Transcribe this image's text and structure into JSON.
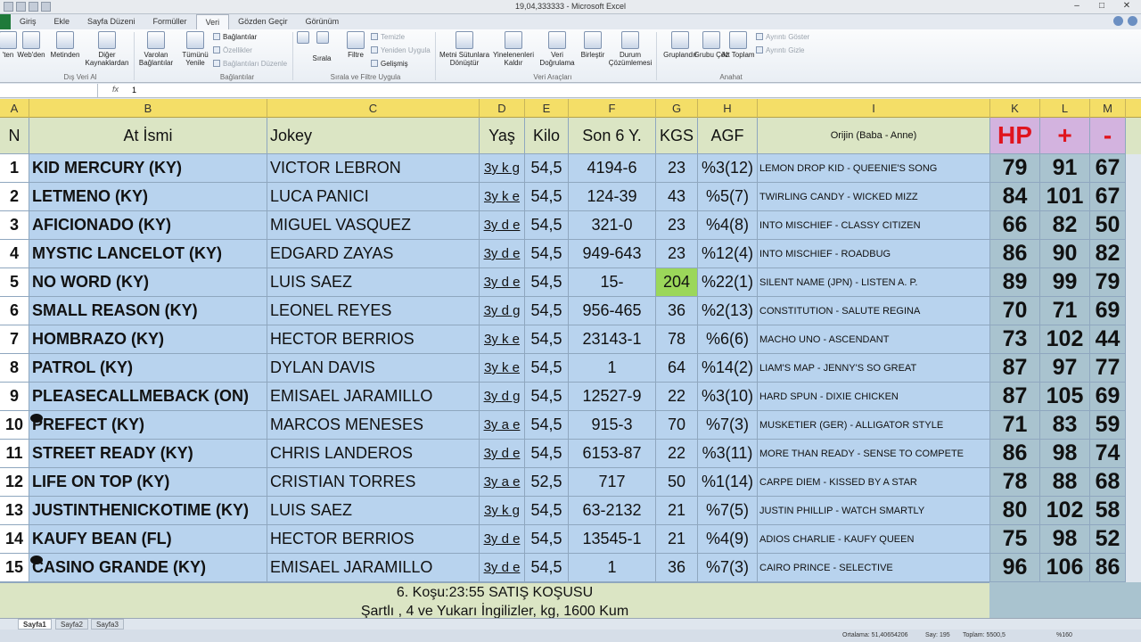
{
  "window": {
    "title": "19,04,333333 - Microsoft Excel"
  },
  "tabs": [
    "",
    "Giriş",
    "Ekle",
    "Sayfa Düzeni",
    "Formüller",
    "Veri",
    "Gözden Geçir",
    "Görünüm"
  ],
  "ribbon": {
    "buttons": [
      "'ten",
      "Web'den",
      "Metinden",
      "Diğer Kaynaklardan",
      "Varolan Bağlantılar",
      "Tümünü Yenile",
      "Sırala",
      "Filtre",
      "Metni Sütunlara Dönüştür",
      "Yinelenenleri Kaldır",
      "Veri Doğrulama",
      "Birleştir",
      "Durum Çözümlemesi",
      "Gruplandır",
      "Grubu Çöz",
      "Alt Toplam"
    ],
    "small": [
      "Bağlantılar",
      "Özellikler",
      "Bağlantıları Düzenle",
      "Temizle",
      "Yeniden Uygula",
      "Gelişmiş",
      "Ayrıntı Göster",
      "Ayrıntı Gizle"
    ],
    "groups": [
      "Dış Veri Al",
      "Bağlantılar",
      "Sırala ve Filtre Uygula",
      "Veri Araçları",
      "Anahat"
    ]
  },
  "formula": {
    "fx": "fx",
    "value": "1"
  },
  "col_headers": [
    "A",
    "B",
    "C",
    "D",
    "E",
    "F",
    "G",
    "H",
    "I",
    "K",
    "L",
    "M"
  ],
  "header_row": {
    "n": "N",
    "name": "At İsmi",
    "jokey": "Jokey",
    "yas": "Yaş",
    "kilo": "Kilo",
    "son": "Son 6 Y.",
    "kgs": "KGS",
    "agf": "AGF",
    "orijin": "Orijin (Baba - Anne)",
    "hp": "HP",
    "plus": "+",
    "minus": "-"
  },
  "rows": [
    {
      "n": "1",
      "name": "KID MERCURY (KY)",
      "jokey": "VICTOR LEBRON",
      "yas": "3y k g",
      "kilo": "54,5",
      "son": "4194-6",
      "kgs": "23",
      "agf": "%3(12)",
      "orijin": "LEMON DROP KID - QUEENIE'S SONG",
      "hp": "79",
      "plus": "91",
      "minus": "67"
    },
    {
      "n": "2",
      "name": "LETMENO (KY)",
      "jokey": "LUCA PANICI",
      "yas": "3y k e",
      "kilo": "54,5",
      "son": "124-39",
      "kgs": "43",
      "agf": "%5(7)",
      "orijin": "TWIRLING CANDY - WICKED MIZZ",
      "hp": "84",
      "plus": "101",
      "minus": "67"
    },
    {
      "n": "3",
      "name": "AFICIONADO (KY)",
      "jokey": "MIGUEL VASQUEZ",
      "yas": "3y d e",
      "kilo": "54,5",
      "son": "321-0",
      "kgs": "23",
      "agf": "%4(8)",
      "orijin": "INTO MISCHIEF - CLASSY CITIZEN",
      "hp": "66",
      "plus": "82",
      "minus": "50"
    },
    {
      "n": "4",
      "name": "MYSTIC LANCELOT (KY)",
      "jokey": "EDGARD ZAYAS",
      "yas": "3y d e",
      "kilo": "54,5",
      "son": "949-643",
      "kgs": "23",
      "agf": "%12(4)",
      "orijin": "INTO MISCHIEF - ROADBUG",
      "hp": "86",
      "plus": "90",
      "minus": "82"
    },
    {
      "n": "5",
      "name": "NO WORD (KY)",
      "jokey": "LUIS SAEZ",
      "yas": "3y d e",
      "kilo": "54,5",
      "son": "15-",
      "kgs": "204",
      "agf": "%22(1)",
      "orijin": "SILENT NAME (JPN) - LISTEN A. P.",
      "hp": "89",
      "plus": "99",
      "minus": "79"
    },
    {
      "n": "6",
      "name": "SMALL REASON (KY)",
      "jokey": "LEONEL REYES",
      "yas": "3y d g",
      "kilo": "54,5",
      "son": "956-465",
      "kgs": "36",
      "agf": "%2(13)",
      "orijin": "CONSTITUTION - SALUTE REGINA",
      "hp": "70",
      "plus": "71",
      "minus": "69"
    },
    {
      "n": "7",
      "name": "HOMBRAZO (KY)",
      "jokey": "HECTOR BERRIOS",
      "yas": "3y k e",
      "kilo": "54,5",
      "son": "23143-1",
      "kgs": "78",
      "agf": "%6(6)",
      "orijin": "MACHO UNO - ASCENDANT",
      "hp": "73",
      "plus": "102",
      "minus": "44"
    },
    {
      "n": "8",
      "name": "PATROL (KY)",
      "jokey": "DYLAN DAVIS",
      "yas": "3y k e",
      "kilo": "54,5",
      "son": "1",
      "kgs": "64",
      "agf": "%14(2)",
      "orijin": "LIAM'S MAP - JENNY'S SO GREAT",
      "hp": "87",
      "plus": "97",
      "minus": "77"
    },
    {
      "n": "9",
      "name": "PLEASECALLMEBACK (ON)",
      "jokey": "EMISAEL JARAMILLO",
      "yas": "3y d g",
      "kilo": "54,5",
      "son": "12527-9",
      "kgs": "22",
      "agf": "%3(10)",
      "orijin": "HARD SPUN - DIXIE CHICKEN",
      "hp": "87",
      "plus": "105",
      "minus": "69"
    },
    {
      "n": "10",
      "name": "PREFECT (KY)",
      "jokey": "MARCOS MENESES",
      "yas": "3y a e",
      "kilo": "54,5",
      "son": "915-3",
      "kgs": "70",
      "agf": "%7(3)",
      "orijin": "MUSKETIER (GER) - ALLIGATOR STYLE",
      "hp": "71",
      "plus": "83",
      "minus": "59"
    },
    {
      "n": "11",
      "name": "STREET READY (KY)",
      "jokey": "CHRIS LANDEROS",
      "yas": "3y d e",
      "kilo": "54,5",
      "son": "6153-87",
      "kgs": "22",
      "agf": "%3(11)",
      "orijin": "MORE THAN READY - SENSE TO COMPETE",
      "hp": "86",
      "plus": "98",
      "minus": "74"
    },
    {
      "n": "12",
      "name": "LIFE ON TOP (KY)",
      "jokey": "CRISTIAN TORRES",
      "yas": "3y a e",
      "kilo": "52,5",
      "son": "717",
      "kgs": "50",
      "agf": "%1(14)",
      "orijin": "CARPE DIEM - KISSED BY A STAR",
      "hp": "78",
      "plus": "88",
      "minus": "68"
    },
    {
      "n": "13",
      "name": "JUSTINTHENICKOTIME (KY)",
      "jokey": "LUIS SAEZ",
      "yas": "3y k g",
      "kilo": "54,5",
      "son": "63-2132",
      "kgs": "21",
      "agf": "%7(5)",
      "orijin": "JUSTIN PHILLIP - WATCH SMARTLY",
      "hp": "80",
      "plus": "102",
      "minus": "58"
    },
    {
      "n": "14",
      "name": "KAUFY BEAN (FL)",
      "jokey": "HECTOR BERRIOS",
      "yas": "3y d e",
      "kilo": "54,5",
      "son": "13545-1",
      "kgs": "21",
      "agf": "%4(9)",
      "orijin": "ADIOS CHARLIE - KAUFY QUEEN",
      "hp": "75",
      "plus": "98",
      "minus": "52"
    },
    {
      "n": "15",
      "name": "CASINO GRANDE (KY)",
      "jokey": "EMISAEL JARAMILLO",
      "yas": "3y d e",
      "kilo": "54,5",
      "son": "1",
      "kgs": "36",
      "agf": "%7(3)",
      "orijin": "CAIRO PRINCE - SELECTIVE",
      "hp": "96",
      "plus": "106",
      "minus": "86"
    }
  ],
  "race": {
    "line1": "6. Koşu:23:55 SATIŞ KOŞUSU",
    "line2": "Şartlı , 4 ve Yukarı İngilizler, kg, 1600 Kum"
  },
  "sheets": [
    "Sayfa1",
    "Sayfa2",
    "Sayfa3"
  ],
  "status": {
    "avg": "Ortalama: 51,40654206",
    "count": "Say: 195",
    "sum": "Toplam: 5500,5",
    "zoom": "%160"
  },
  "colors": {
    "header_yellow": "#f4de67",
    "row_blue": "#b8d3ee",
    "stat_teal": "#a9c3cf",
    "header_green": "#dbe5c4",
    "hp_purple": "#d3b3df",
    "hp_red": "#e0141e",
    "highlight_green": "#9bd75a"
  }
}
